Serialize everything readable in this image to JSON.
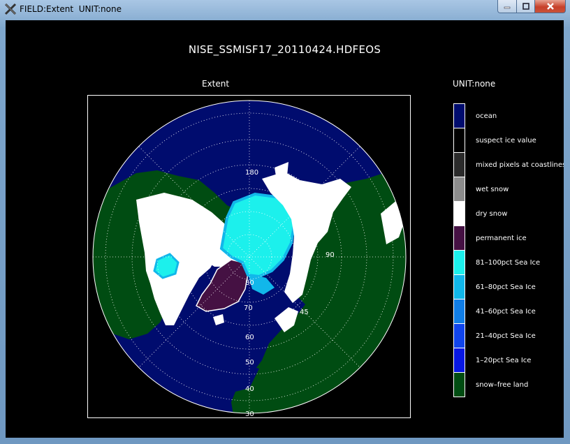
{
  "window": {
    "title": "FIELD:Extent  UNIT:none",
    "icon": "x-window-icon",
    "buttons": {
      "minimize": "minimize-icon",
      "maximize": "maximize-icon",
      "close": "close-icon"
    }
  },
  "plot": {
    "title": "NISE_SSMISF17_20110424.HDFEOS",
    "map_label": "Extent",
    "unit_label": "UNIT:none"
  },
  "map": {
    "projection": "north-polar-stereographic",
    "longitude_labels": [
      "180",
      "90",
      "45"
    ],
    "latitude_labels": [
      "80",
      "70",
      "60",
      "50",
      "40",
      "30"
    ],
    "graticule": "dotted white",
    "coastlines": "white"
  },
  "legend": {
    "items": [
      {
        "label": "ocean",
        "color": "#000c6e"
      },
      {
        "label": "suspect ice value",
        "color": "#000000"
      },
      {
        "label": "mixed pixels at coastlines",
        "color": "#2b2b2b"
      },
      {
        "label": "wet snow",
        "color": "#8c8c8c"
      },
      {
        "label": "dry snow",
        "color": "#ffffff"
      },
      {
        "label": "permanent ice",
        "color": "#451143"
      },
      {
        "label": "81–100pct Sea Ice",
        "color": "#1cf0ec"
      },
      {
        "label": "61–80pct Sea Ice",
        "color": "#11b7ea"
      },
      {
        "label": "41–60pct Sea Ice",
        "color": "#117ee6"
      },
      {
        "label": "21–40pct Sea Ice",
        "color": "#1145ec"
      },
      {
        "label": "1–20pct Sea Ice",
        "color": "#0818e3"
      },
      {
        "label": "snow–free land",
        "color": "#004c12"
      }
    ]
  }
}
